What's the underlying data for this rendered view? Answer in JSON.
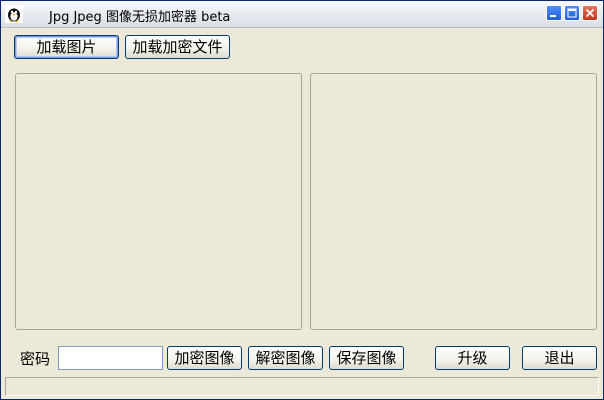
{
  "window": {
    "title": "Jpg Jpeg 图像无损加密器 beta",
    "icon": "app-icon",
    "controls": {
      "minimize_icon": "minimize-icon",
      "maximize_icon": "maximize-icon",
      "close_icon": "close-icon"
    },
    "colors": {
      "frame": "#0a246a",
      "body": "#ece9d8",
      "close": "#c1361c",
      "caption_buttons": "#1f5fd9"
    }
  },
  "toolbar": {
    "load_image_label": "加载图片",
    "load_encrypted_label": "加载加密文件"
  },
  "bottom": {
    "password_label": "密码",
    "password_value": "",
    "password_placeholder": "",
    "encrypt_label": "加密图像",
    "decrypt_label": "解密图像",
    "save_label": "保存图像",
    "upgrade_label": "升级",
    "exit_label": "退出"
  }
}
